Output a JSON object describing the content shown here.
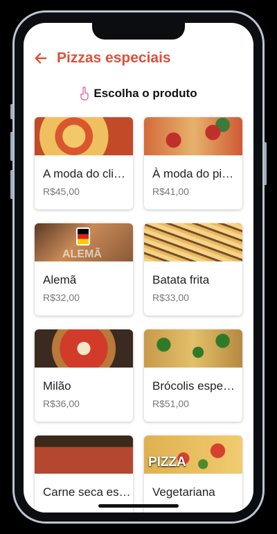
{
  "header": {
    "title": "Pizzas especiais"
  },
  "section": {
    "title": "Escolha o produto"
  },
  "products": [
    {
      "name": "A moda do cli…",
      "price": "R$45,00"
    },
    {
      "name": "À moda do pi…",
      "price": "R$41,00"
    },
    {
      "name": "Alemã",
      "price": "R$32,00",
      "image_text": "ALEMÃ"
    },
    {
      "name": "Batata frita",
      "price": "R$33,00"
    },
    {
      "name": "Milão",
      "price": "R$36,00"
    },
    {
      "name": "Brócolis espe…",
      "price": "R$51,00"
    },
    {
      "name": "Carne seca es…",
      "price": ""
    },
    {
      "name": "Vegetariana",
      "price": "",
      "image_text": "PIZZA"
    }
  ],
  "colors": {
    "accent": "#e04f3c"
  }
}
